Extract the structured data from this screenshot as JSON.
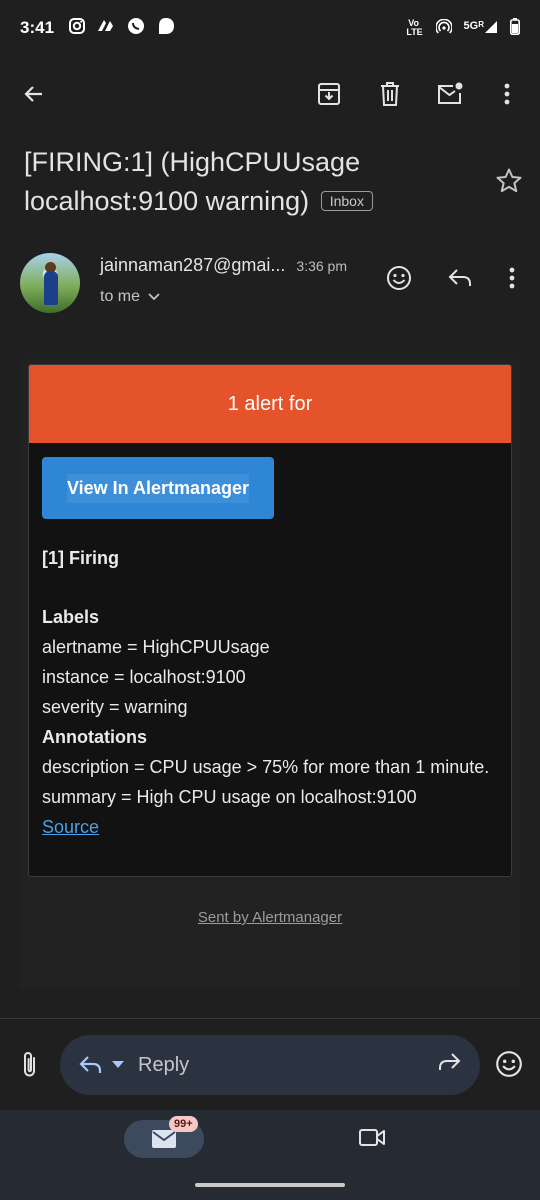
{
  "status_bar": {
    "time": "3:41",
    "network_label": "5G",
    "roaming": "R",
    "volte": "Vo LTE"
  },
  "toolbar": {
    "icons": [
      "back-arrow-icon",
      "archive-icon",
      "delete-icon",
      "mark-unread-icon",
      "more-vert-icon"
    ]
  },
  "email": {
    "subject": "[FIRING:1]  (HighCPUUsage localhost:9100 warning)",
    "folder_badge": "Inbox",
    "sender": "jainnaman287@gmai...",
    "time": "3:36 pm",
    "recipient": "to me"
  },
  "alert": {
    "header": "1 alert for",
    "header_color": "#e5532b",
    "button_label": "View In Alertmanager",
    "button_color": "#2f86d4",
    "firing_title": "[1] Firing",
    "labels_heading": "Labels",
    "labels": [
      "alertname = HighCPUUsage",
      "instance = localhost:9100",
      "severity = warning"
    ],
    "annotations_heading": "Annotations",
    "annotations": [
      "description = CPU usage > 75% for more than 1 minute.",
      "summary = High CPU usage on localhost:9100"
    ],
    "source_link": "Source",
    "footer": "Sent by Alertmanager"
  },
  "reply_bar": {
    "reply_label": "Reply"
  },
  "bottom_nav": {
    "mail_badge": "99+"
  }
}
